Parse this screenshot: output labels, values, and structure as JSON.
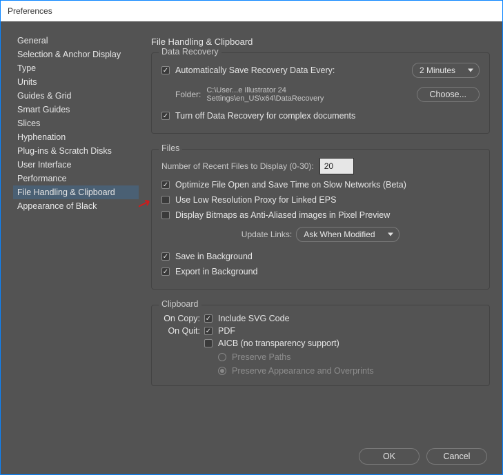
{
  "window": {
    "title": "Preferences"
  },
  "sidebar": {
    "items": [
      "General",
      "Selection & Anchor Display",
      "Type",
      "Units",
      "Guides & Grid",
      "Smart Guides",
      "Slices",
      "Hyphenation",
      "Plug-ins & Scratch Disks",
      "User Interface",
      "Performance",
      "File Handling & Clipboard",
      "Appearance of Black"
    ],
    "selected_index": 11
  },
  "content": {
    "title": "File Handling & Clipboard",
    "data_recovery": {
      "group_title": "Data Recovery",
      "auto_save_label": "Automatically Save Recovery Data Every:",
      "auto_save_checked": true,
      "interval_value": "2 Minutes",
      "folder_label": "Folder:",
      "folder_path": "C:\\User...e Illustrator 24 Settings\\en_US\\x64\\DataRecovery",
      "choose_label": "Choose...",
      "turn_off_label": "Turn off Data Recovery for complex documents",
      "turn_off_checked": true
    },
    "files": {
      "group_title": "Files",
      "recent_label": "Number of Recent Files to Display (0-30):",
      "recent_value": "20",
      "optimize_label": "Optimize File Open and Save Time on Slow Networks (Beta)",
      "optimize_checked": true,
      "low_res_label": "Use Low Resolution Proxy for Linked EPS",
      "low_res_checked": false,
      "bitmaps_label": "Display Bitmaps as Anti-Aliased images in Pixel Preview",
      "bitmaps_checked": false,
      "update_links_label": "Update Links:",
      "update_links_value": "Ask When Modified",
      "save_bg_label": "Save in Background",
      "save_bg_checked": true,
      "export_bg_label": "Export in Background",
      "export_bg_checked": true
    },
    "clipboard": {
      "group_title": "Clipboard",
      "on_copy_label": "On Copy:",
      "include_svg_label": "Include SVG Code",
      "include_svg_checked": true,
      "on_quit_label": "On Quit:",
      "pdf_label": "PDF",
      "pdf_checked": true,
      "aicb_label": "AICB (no transparency support)",
      "aicb_checked": false,
      "preserve_paths_label": "Preserve Paths",
      "preserve_appearance_label": "Preserve Appearance and Overprints",
      "selected_disabled_radio": "appearance"
    }
  },
  "footer": {
    "ok": "OK",
    "cancel": "Cancel"
  }
}
